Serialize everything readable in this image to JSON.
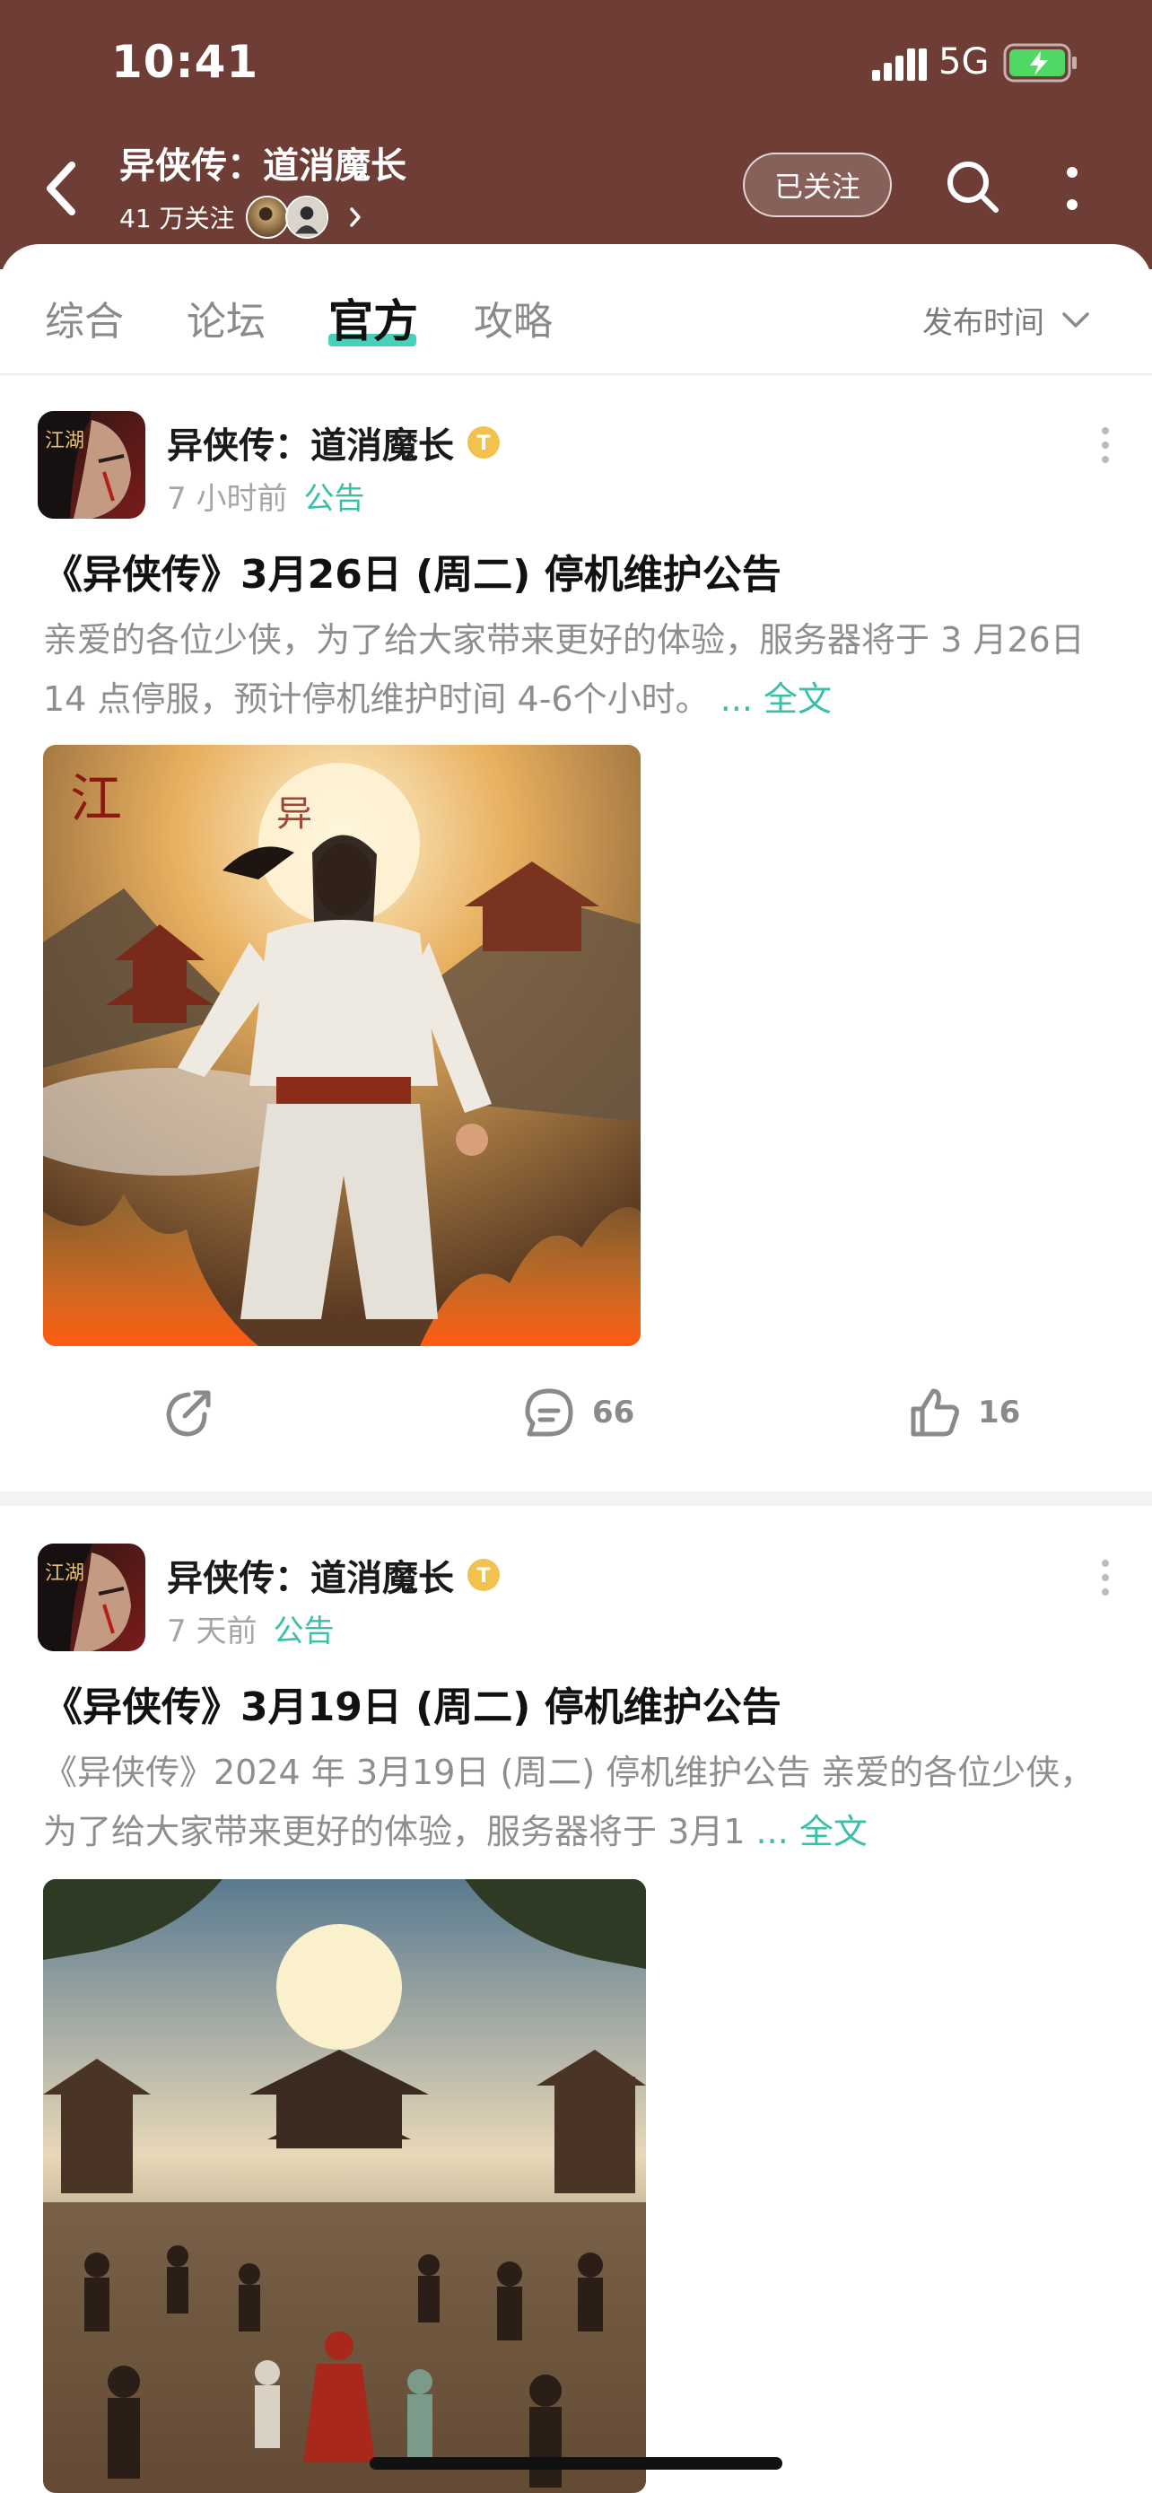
{
  "status_bar": {
    "time": "10:41",
    "network": "5G",
    "icons": [
      "signal-icon",
      "battery-charging-icon"
    ]
  },
  "header": {
    "title": "异侠传：道消魔长",
    "followers": "41 万关注",
    "follow_button": "已关注",
    "icons": [
      "back-icon",
      "search-icon",
      "more-icon",
      "chevron-right-icon"
    ]
  },
  "tabs": [
    {
      "label": "综合"
    },
    {
      "label": "论坛"
    },
    {
      "label": "官方",
      "active": true
    },
    {
      "label": "攻略"
    }
  ],
  "sort": {
    "label": "发布时间"
  },
  "posts": [
    {
      "author": "异侠传：道消魔长",
      "time": "7 小时前",
      "tag": "公告",
      "title": "《异侠传》3月26日 (周二) 停机维护公告",
      "excerpt": "亲爱的各位少侠，为了给大家带来更好的体验，服务器将于 3 月26日14 点停服，预计停机维护时间 4-6个小时。",
      "more": "... 全文",
      "image_alt": "swordsman in white robe amid flames and temples",
      "comments": "66",
      "likes": "16"
    },
    {
      "author": "异侠传：道消魔长",
      "time": "7 天前",
      "tag": "公告",
      "title": "《异侠传》3月19日 (周二) 停机维护公告",
      "excerpt": "《异侠传》2024 年 3月19日 (周二) 停机维护公告  亲爱的各位少侠，为了给大家带来更好的体验，服务器将于 3月1",
      "more": "... 全文",
      "image_alt": "martial artists gathering before a temple under the moon"
    }
  ],
  "colors": {
    "header": "#6e3d36",
    "accent": "#3cbfa9",
    "tab_underline": "#48d0b8"
  }
}
